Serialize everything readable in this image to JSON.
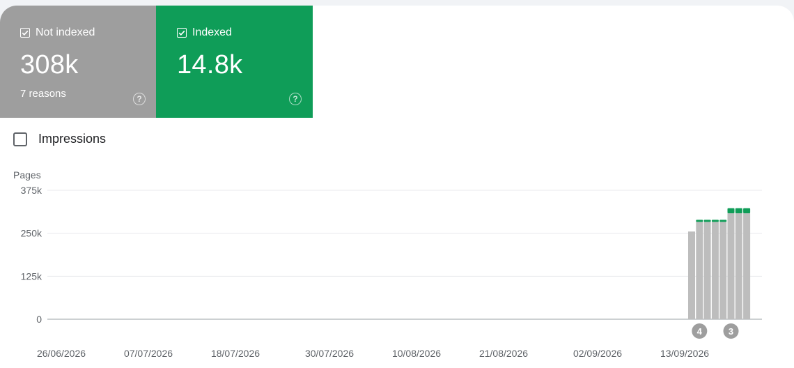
{
  "tiles": {
    "not_indexed": {
      "label": "Not indexed",
      "value": "308k",
      "sub": "7 reasons",
      "color": "#9e9e9e",
      "checked": true
    },
    "indexed": {
      "label": "Indexed",
      "value": "14.8k",
      "color": "#0f9d58",
      "checked": true
    }
  },
  "help_icon": "?",
  "impressions": {
    "label": "Impressions",
    "checked": false
  },
  "chart_data": {
    "type": "bar",
    "stacked": true,
    "ylabel": "Pages",
    "yticks": [
      "375k",
      "250k",
      "125k",
      "0"
    ],
    "ylim": [
      0,
      375000
    ],
    "xticks": [
      "26/06/2026",
      "07/07/2026",
      "18/07/2026",
      "30/07/2026",
      "10/08/2026",
      "21/08/2026",
      "02/09/2026",
      "13/09/2026"
    ],
    "grid": true,
    "colors": {
      "not_indexed": "#bdbdbd",
      "indexed": "#0f9d58"
    },
    "dates": [
      "14/09/2026",
      "15/09/2026",
      "16/09/2026",
      "17/09/2026",
      "18/09/2026",
      "19/09/2026",
      "20/09/2026",
      "21/09/2026"
    ],
    "series": [
      {
        "values": [
          255000,
          283000,
          283000,
          283000,
          283000,
          308000,
          308000,
          308000
        ]
      },
      {
        "values": [
          0,
          5000,
          5000,
          5000,
          5000,
          14800,
          14800,
          14800
        ]
      }
    ],
    "annotations": [
      {
        "label": "4",
        "index": 1
      },
      {
        "label": "3",
        "index": 5
      }
    ]
  }
}
